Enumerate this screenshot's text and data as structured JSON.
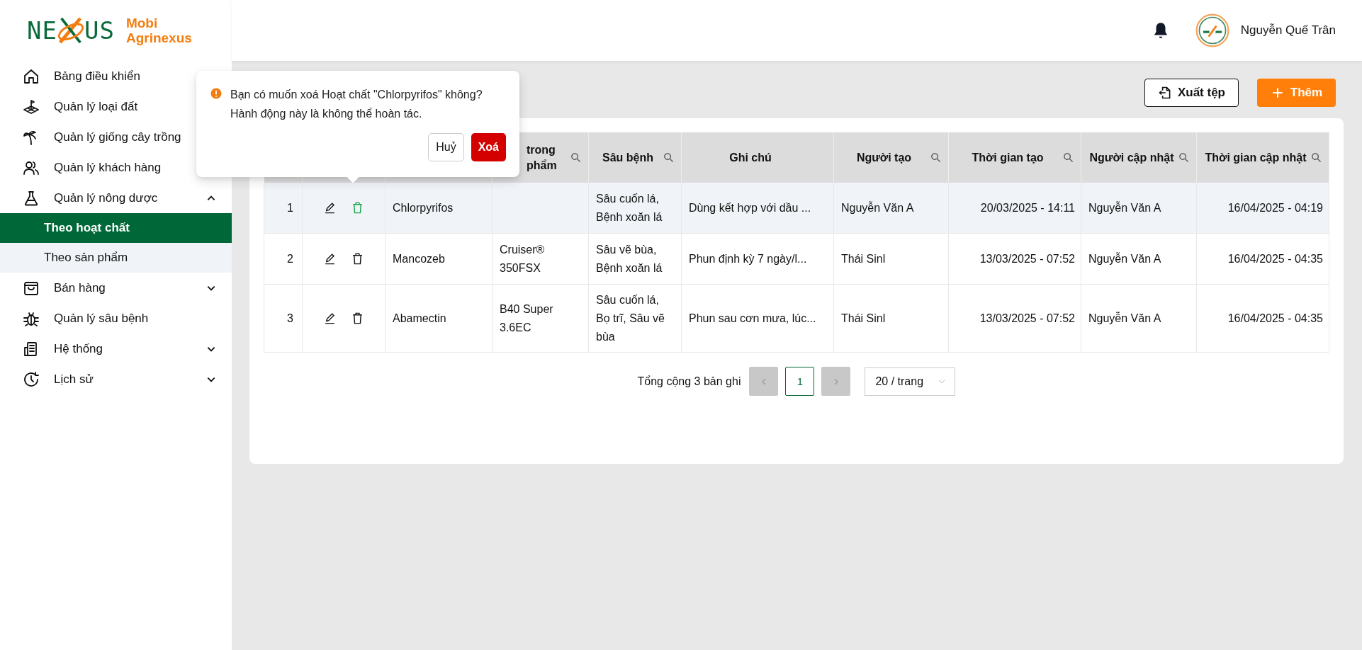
{
  "brand": {
    "logo_left": "NE",
    "logo_right": "US",
    "name_top": "Mobi",
    "name_bottom": "Agrinexus"
  },
  "sidebar": {
    "items": [
      {
        "kind": "item",
        "label": "Bảng điều khiển"
      },
      {
        "kind": "item",
        "label": "Quản lý loại đất"
      },
      {
        "kind": "item",
        "label": "Quản lý giống cây trồng"
      },
      {
        "kind": "item",
        "label": "Quản lý khách hàng"
      },
      {
        "kind": "group",
        "label": "Quản lý nông dược",
        "expanded": true,
        "children": [
          {
            "label": "Theo hoạt chất",
            "selected": true
          },
          {
            "label": "Theo sản phẩm",
            "selected": false
          }
        ]
      },
      {
        "kind": "group",
        "label": "Bán hàng",
        "expanded": false
      },
      {
        "kind": "item",
        "label": "Quản lý sâu bệnh"
      },
      {
        "kind": "group",
        "label": "Hệ thống",
        "expanded": false
      },
      {
        "kind": "group",
        "label": "Lịch sử",
        "expanded": false
      }
    ]
  },
  "header": {
    "user_name": "Nguyễn Quế Trân"
  },
  "toolbar": {
    "export_button": "Xuất tệp",
    "add_button": "Thêm"
  },
  "table": {
    "columns": [
      {
        "label_line_1": "trong",
        "label_line_2": "phẩm",
        "search": true
      },
      {
        "label": "Sâu bệnh",
        "search": true
      },
      {
        "label": "Ghi chú"
      },
      {
        "label": "Người tạo",
        "search": true
      },
      {
        "label": "Thời gian tạo",
        "search": true
      },
      {
        "label": "Người cập nhật",
        "search": true
      },
      {
        "label": "Thời gian cập nhật",
        "search": true
      }
    ],
    "rows": [
      {
        "selected": true,
        "index": "1",
        "name": "Chlorpyrifos",
        "product": "",
        "pest": "Sâu cuốn lá, Bệnh xoăn lá",
        "note": "Dùng kết hợp với dầu ...",
        "creator": "Nguyễn Văn A",
        "created": "20/03/2025 - 14:11",
        "updater": "Nguyễn Văn A",
        "updated": "16/04/2025 - 04:19"
      },
      {
        "selected": false,
        "index": "2",
        "name": "Mancozeb",
        "product": "Cruiser® 350FSX",
        "pest": "Sâu vẽ bùa, Bệnh xoăn lá",
        "note": "Phun định kỳ 7 ngày/l...",
        "creator": "Thái Sinl",
        "created": "13/03/2025 - 07:52",
        "updater": "Nguyễn Văn A",
        "updated": "16/04/2025 - 04:35"
      },
      {
        "selected": false,
        "index": "3",
        "name": "Abamectin",
        "product": "B40 Super 3.6EC",
        "pest": "Sâu cuốn lá, Bọ trĩ, Sâu vẽ bùa",
        "note": "Phun sau cơn mưa, lúc...",
        "creator": "Thái Sinl",
        "created": "13/03/2025 - 07:52",
        "updater": "Nguyễn Văn A",
        "updated": "16/04/2025 - 04:35"
      }
    ]
  },
  "pagination": {
    "total": "Tổng cộng 3 bản ghi",
    "page": "1",
    "prev_disabled": true,
    "next_disabled": true,
    "page_size": "20 / trang"
  },
  "confirm": {
    "message": "Bạn có muốn xoá Hoạt chất \"Chlorpyrifos\" không? Hành động này là không thể hoàn tác.",
    "cancel": "Huỷ",
    "ok": "Xoá"
  }
}
